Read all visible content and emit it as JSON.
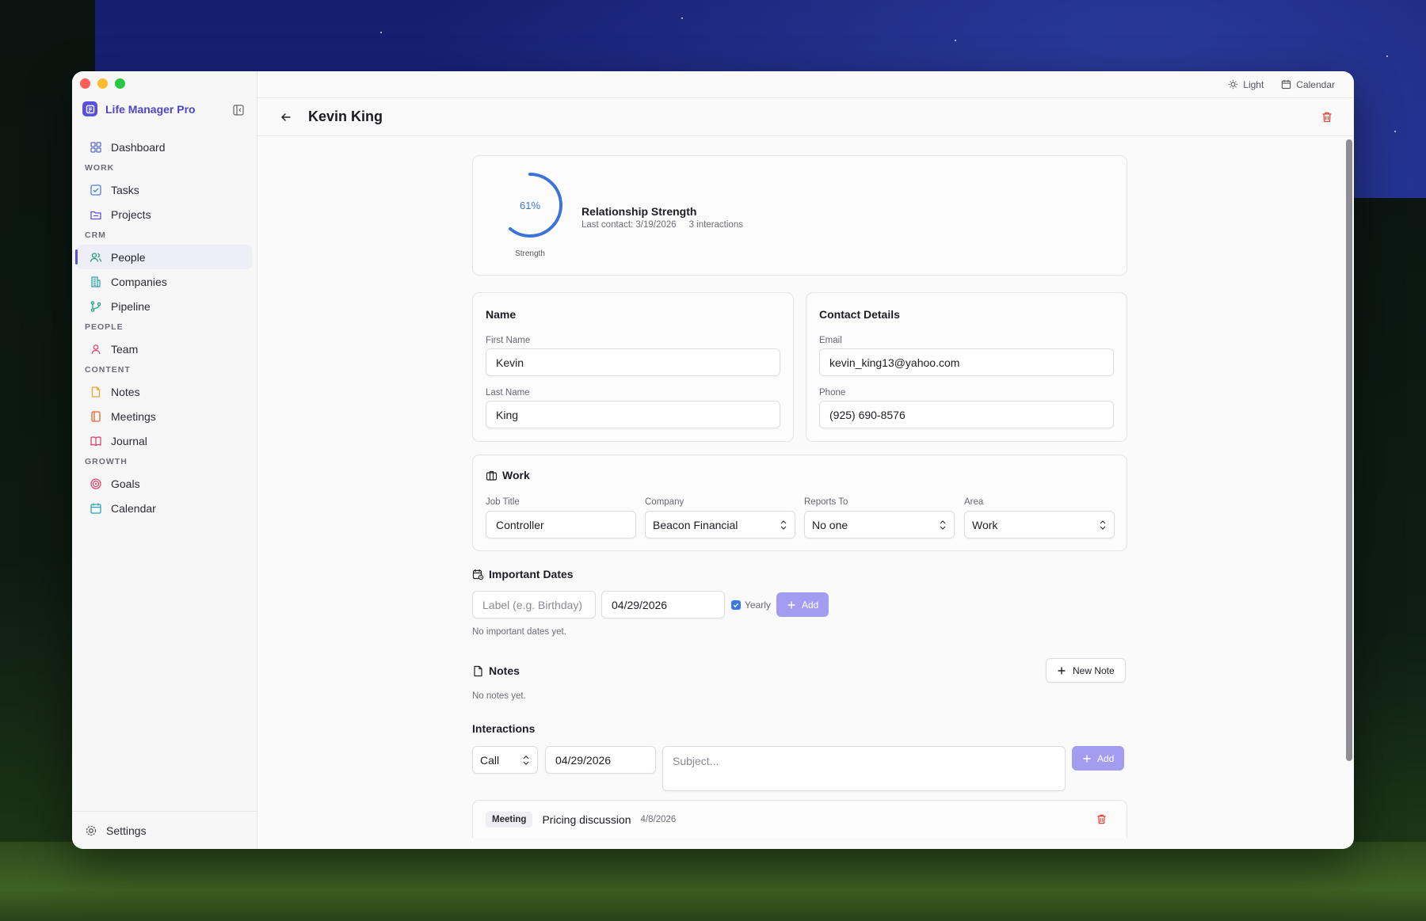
{
  "app": {
    "name": "Life Manager Pro"
  },
  "sidebar": {
    "items": [
      {
        "type": "item",
        "label": "Dashboard",
        "icon": "dashboard-icon",
        "color": "#5b6cc9",
        "active": false
      },
      {
        "type": "section",
        "label": "WORK"
      },
      {
        "type": "item",
        "label": "Tasks",
        "icon": "check-square-icon",
        "color": "#4a7fe0",
        "active": false
      },
      {
        "type": "item",
        "label": "Projects",
        "icon": "folder-icon",
        "color": "#5b4fe0",
        "active": false
      },
      {
        "type": "section",
        "label": "CRM"
      },
      {
        "type": "item",
        "label": "People",
        "icon": "users-icon",
        "color": "#27a07a",
        "active": true
      },
      {
        "type": "item",
        "label": "Companies",
        "icon": "building-icon",
        "color": "#2aa4b4",
        "active": false
      },
      {
        "type": "item",
        "label": "Pipeline",
        "icon": "git-branch-icon",
        "color": "#1fa382",
        "active": false
      },
      {
        "type": "section",
        "label": "PEOPLE"
      },
      {
        "type": "item",
        "label": "Team",
        "icon": "user-group-icon",
        "color": "#e0466b",
        "active": false
      },
      {
        "type": "section",
        "label": "CONTENT"
      },
      {
        "type": "item",
        "label": "Notes",
        "icon": "file-icon",
        "color": "#e8a532",
        "active": false
      },
      {
        "type": "item",
        "label": "Meetings",
        "icon": "presentation-icon",
        "color": "#e8642e",
        "active": false
      },
      {
        "type": "item",
        "label": "Journal",
        "icon": "book-icon",
        "color": "#e0466b",
        "active": false
      },
      {
        "type": "section",
        "label": "GROWTH"
      },
      {
        "type": "item",
        "label": "Goals",
        "icon": "target-icon",
        "color": "#e0466b",
        "active": false
      },
      {
        "type": "item",
        "label": "Calendar",
        "icon": "calendar-icon",
        "color": "#2aa4b4",
        "active": false
      }
    ],
    "settings_label": "Settings"
  },
  "topbar": {
    "theme_label": "Light",
    "calendar_label": "Calendar"
  },
  "header": {
    "title": "Kevin King"
  },
  "strength": {
    "percent": 61,
    "percent_label": "61%",
    "ring_label": "Strength",
    "title": "Relationship Strength",
    "last_contact": "Last contact: 3/19/2026",
    "interactions": "3 interactions",
    "color": "#3b73d8"
  },
  "name_card": {
    "title": "Name",
    "first_name_label": "First Name",
    "first_name": "Kevin",
    "last_name_label": "Last Name",
    "last_name": "King"
  },
  "contact_card": {
    "title": "Contact Details",
    "email_label": "Email",
    "email": "kevin_king13@yahoo.com",
    "phone_label": "Phone",
    "phone": "(925) 690-8576"
  },
  "work_card": {
    "title": "Work",
    "job_title_label": "Job Title",
    "job_title": "Controller",
    "company_label": "Company",
    "company": "Beacon Financial",
    "reports_to_label": "Reports To",
    "reports_to": "No one",
    "area_label": "Area",
    "area": "Work"
  },
  "important_dates": {
    "title": "Important Dates",
    "label_placeholder": "Label (e.g. Birthday)",
    "date_value": "04/29/2026",
    "yearly_label": "Yearly",
    "yearly_checked": true,
    "add_label": "Add",
    "empty_text": "No important dates yet."
  },
  "notes": {
    "title": "Notes",
    "new_note_label": "New Note",
    "empty_text": "No notes yet."
  },
  "interactions": {
    "title": "Interactions",
    "type_value": "Call",
    "date_value": "04/29/2026",
    "subject_placeholder": "Subject...",
    "add_label": "Add",
    "items": [
      {
        "type": "Meeting",
        "subject": "Pricing discussion",
        "date": "4/8/2026"
      }
    ]
  },
  "colors": {
    "accent": "#5b4fe0",
    "danger": "#e0453a",
    "button_primary": "#a49cf0"
  }
}
